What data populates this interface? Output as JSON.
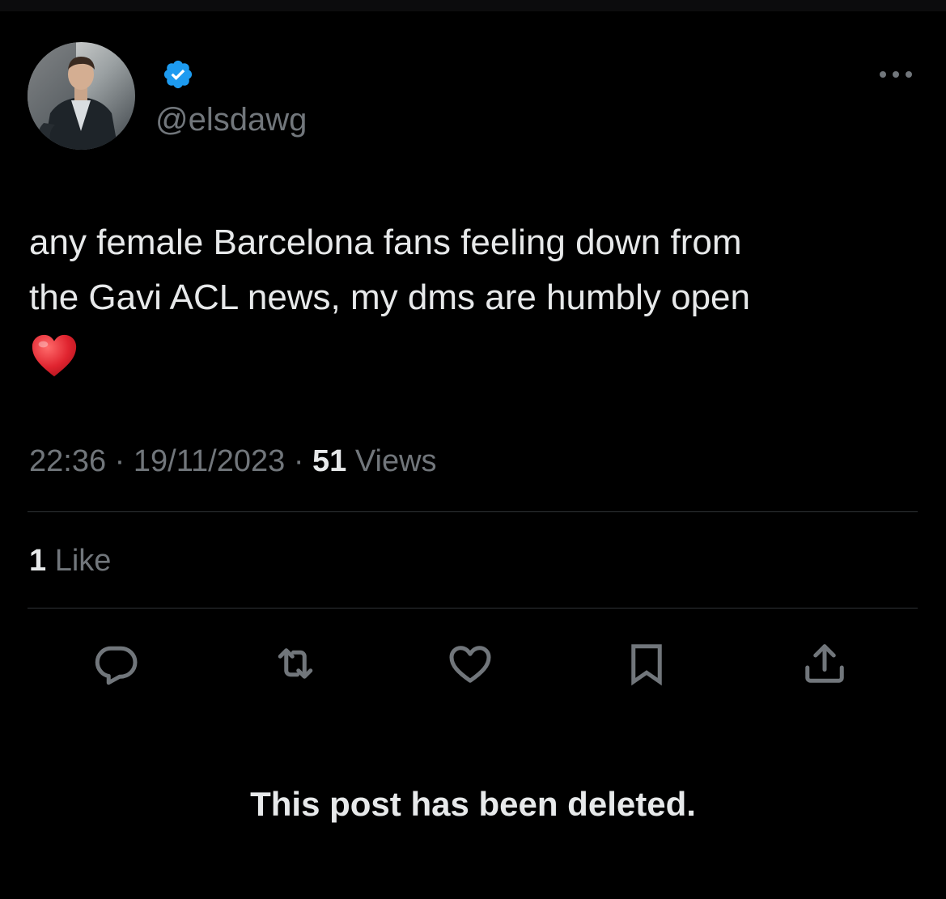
{
  "author": {
    "handle": "@elsdawg",
    "verified": true,
    "avatar": "profile-photo-man-seated"
  },
  "post": {
    "text_line_1": "any female Barcelona fans feeling down from",
    "text_line_2": "the Gavi ACL news, my dms are humbly open",
    "emoji": "red-heart-emoji"
  },
  "meta": {
    "time": "22:36",
    "separator": "·",
    "date": "19/11/2023",
    "views_count": "51",
    "views_label": "Views"
  },
  "engagement": {
    "likes_count": "1",
    "likes_label": "Like"
  },
  "actions": [
    {
      "name": "reply",
      "icon": "speech-bubble-icon"
    },
    {
      "name": "repost",
      "icon": "retweet-arrows-icon"
    },
    {
      "name": "like",
      "icon": "heart-outline-icon"
    },
    {
      "name": "bookmark",
      "icon": "bookmark-icon"
    },
    {
      "name": "share",
      "icon": "share-upload-icon"
    }
  ],
  "notice": {
    "deleted_text": "This post has been deleted."
  },
  "colors": {
    "background": "#000000",
    "primary_text": "#e7e9ea",
    "secondary_text": "#71767b",
    "divider": "#2f3336",
    "verified_badge": "#1d9bf0",
    "emoji_heart": "#e0242f"
  }
}
